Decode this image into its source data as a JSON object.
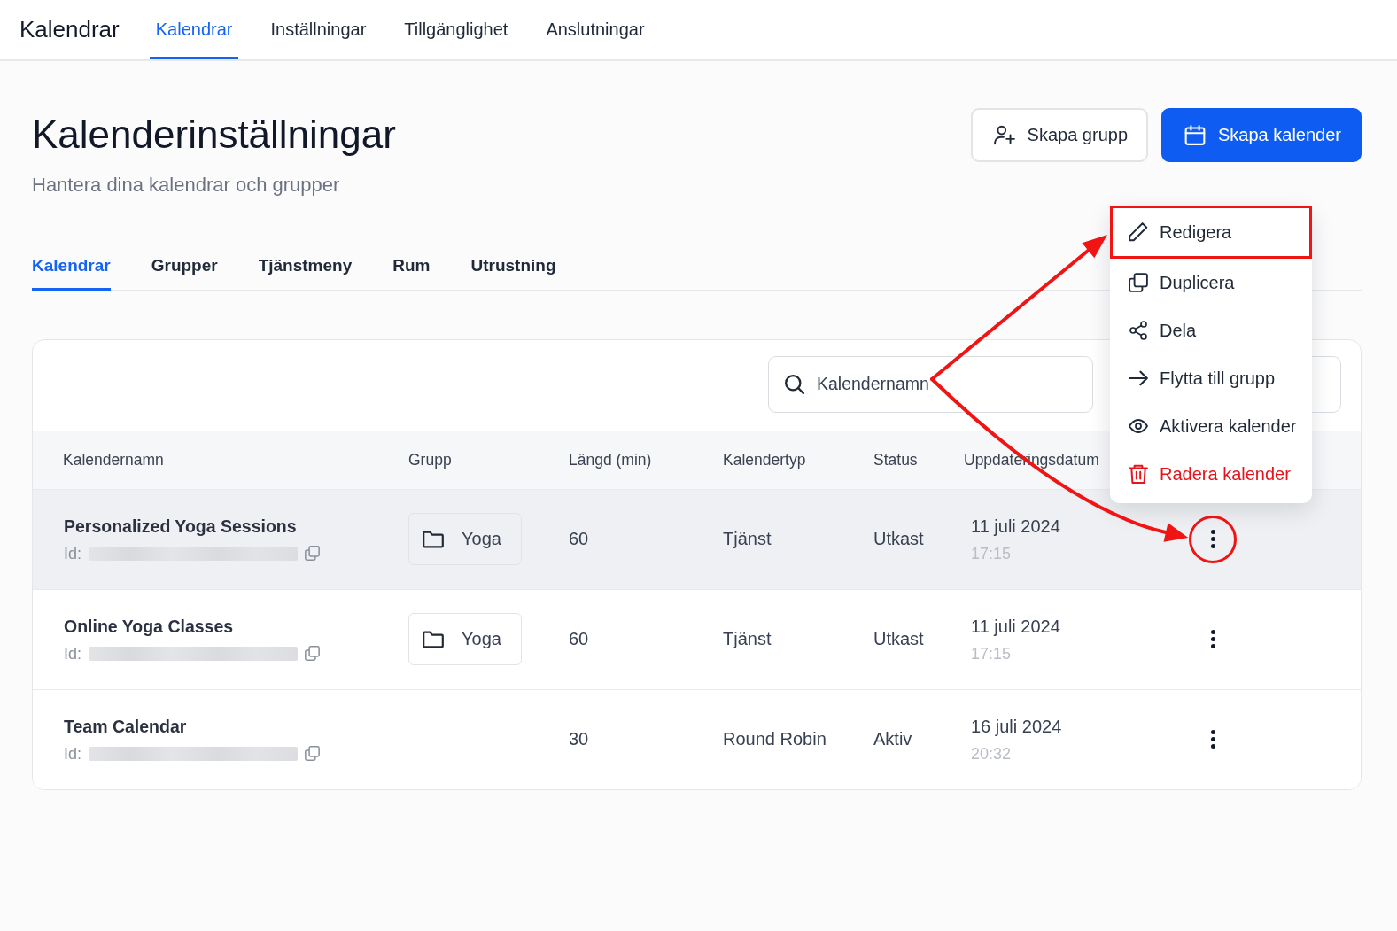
{
  "top_nav": {
    "title": "Kalendrar",
    "tabs": [
      {
        "label": "Kalendrar",
        "selected": true
      },
      {
        "label": "Inställningar",
        "selected": false
      },
      {
        "label": "Tillgänglighet",
        "selected": false
      },
      {
        "label": "Anslutningar",
        "selected": false
      }
    ]
  },
  "header": {
    "title": "Kalenderinställningar",
    "subtitle": "Hantera dina kalendrar och grupper",
    "buttons": [
      {
        "label": "Skapa grupp",
        "kind": "secondary"
      },
      {
        "label": "Skapa kalender",
        "kind": "primary"
      }
    ]
  },
  "section_tabs": [
    {
      "label": "Kalendrar",
      "selected": true
    },
    {
      "label": "Grupper",
      "selected": false
    },
    {
      "label": "Tjänstmeny",
      "selected": false
    },
    {
      "label": "Rum",
      "selected": false
    },
    {
      "label": "Utrustning",
      "selected": false
    }
  ],
  "toolbar": {
    "search": {
      "placeholder": "Kalendernamn"
    }
  },
  "table": {
    "columns": [
      "Kalendernamn",
      "Grupp",
      "Längd (min)",
      "Kalendertyp",
      "Status",
      "Uppdateringsdatum"
    ],
    "rows": [
      {
        "name": "Personalized Yoga Sessions",
        "id_label": "Id:",
        "group": "Yoga",
        "length": "60",
        "type": "Tjänst",
        "status": "Utkast",
        "date": "11 juli 2024",
        "time": "17:15",
        "selected": true,
        "circled": true
      },
      {
        "name": "Online Yoga Classes",
        "id_label": "Id:",
        "group": "Yoga",
        "length": "60",
        "type": "Tjänst",
        "status": "Utkast",
        "date": "11 juli 2024",
        "time": "17:15",
        "selected": false,
        "circled": false
      },
      {
        "name": "Team Calendar",
        "id_label": "Id:",
        "length": "30",
        "type": "Round Robin",
        "status": "Aktiv",
        "date": "16 juli 2024",
        "time": "20:32",
        "selected": false,
        "circled": false
      }
    ]
  },
  "context_menu": {
    "items": [
      {
        "label": "Redigera",
        "kind": "edit",
        "outlined": true
      },
      {
        "label": "Duplicera",
        "kind": "duplicate",
        "outlined": false
      },
      {
        "label": "Dela",
        "kind": "share",
        "outlined": false
      },
      {
        "label": "Flytta till grupp",
        "kind": "move",
        "outlined": false
      },
      {
        "label": "Aktivera kalender",
        "kind": "view",
        "outlined": false
      },
      {
        "label": "Radera kalender",
        "kind": "delete",
        "outlined": false
      }
    ]
  }
}
